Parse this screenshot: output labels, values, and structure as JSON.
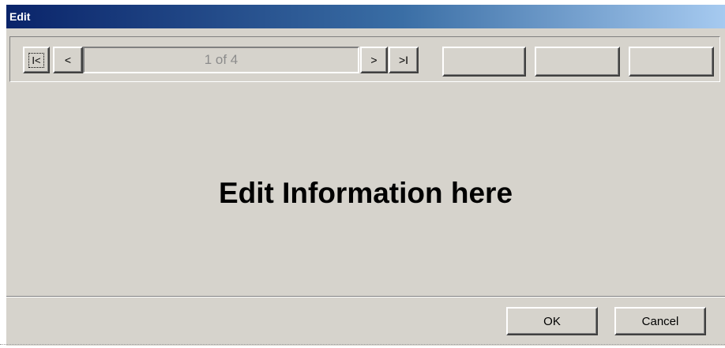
{
  "window": {
    "title": "Edit"
  },
  "navigator": {
    "first_label": "I<",
    "prev_label": "<",
    "record_status": "1 of 4",
    "next_label": ">",
    "last_label": ">I",
    "blank_buttons": [
      "",
      "",
      ""
    ]
  },
  "main": {
    "message": "Edit Information here"
  },
  "dialog_buttons": {
    "ok_label": "OK",
    "cancel_label": "Cancel"
  }
}
